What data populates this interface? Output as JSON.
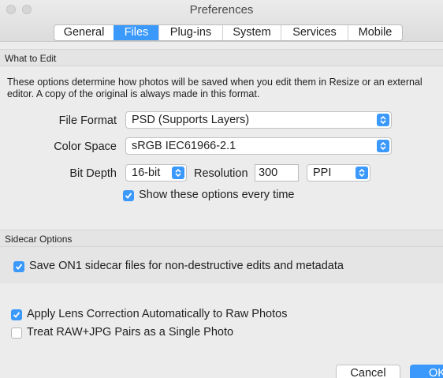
{
  "window": {
    "title": "Preferences"
  },
  "tabs": [
    {
      "label": "General",
      "active": false
    },
    {
      "label": "Files",
      "active": true
    },
    {
      "label": "Plug-ins",
      "active": false
    },
    {
      "label": "System",
      "active": false
    },
    {
      "label": "Services",
      "active": false
    },
    {
      "label": "Mobile",
      "active": false
    }
  ],
  "what_to_edit": {
    "header": "What to Edit",
    "description_line1": "These options determine how photos will be saved when you edit them in Resize or an external",
    "description_line2": "editor.  A copy of the original is always made in this format.",
    "file_format": {
      "label": "File Format",
      "value": "PSD (Supports Layers)"
    },
    "color_space": {
      "label": "Color Space",
      "value": "sRGB IEC61966-2.1"
    },
    "bit_depth": {
      "label": "Bit Depth",
      "value": "16-bit"
    },
    "resolution": {
      "label": "Resolution",
      "value": "300",
      "unit": "PPI"
    },
    "show_options": {
      "label": "Show these options every time",
      "checked": true
    }
  },
  "sidecar": {
    "header": "Sidecar Options",
    "save_sidecar": {
      "label": "Save ON1 sidecar files for non-destructive edits and metadata",
      "checked": true
    }
  },
  "raw": {
    "lens_correction": {
      "label": "Apply Lens Correction Automatically to Raw Photos",
      "checked": true
    },
    "raw_jpg_pairs": {
      "label": "Treat RAW+JPG Pairs as a Single Photo",
      "checked": false
    }
  },
  "buttons": {
    "cancel": "Cancel",
    "ok": "OK"
  },
  "colors": {
    "accent": "#3b99fc",
    "background": "#ececec"
  }
}
